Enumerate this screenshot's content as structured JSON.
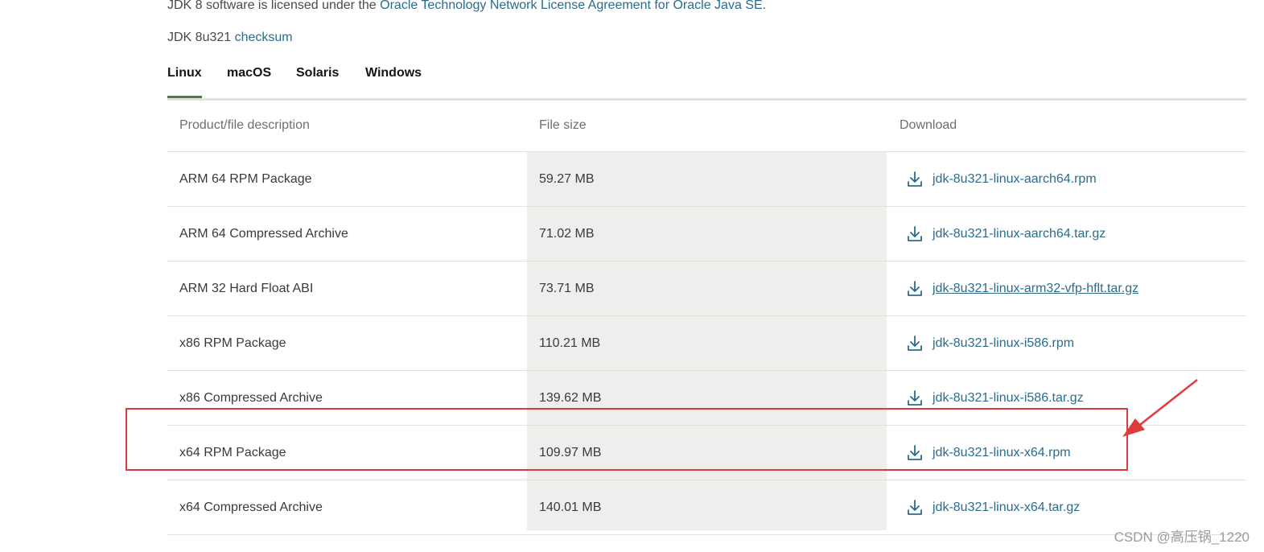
{
  "license": {
    "prefix": "JDK 8 software is licensed under the ",
    "link": "Oracle Technology Network License Agreement for Oracle Java SE",
    "suffix": "."
  },
  "checksum": {
    "prefix": "JDK 8u321 ",
    "link": "checksum"
  },
  "tabs": [
    {
      "label": "Linux",
      "active": true
    },
    {
      "label": "macOS",
      "active": false
    },
    {
      "label": "Solaris",
      "active": false
    },
    {
      "label": "Windows",
      "active": false
    }
  ],
  "table": {
    "headers": [
      "Product/file description",
      "File size",
      "Download"
    ],
    "rows": [
      {
        "description": "ARM 64 RPM Package",
        "size": "59.27 MB",
        "file": "jdk-8u321-linux-aarch64.rpm"
      },
      {
        "description": "ARM 64 Compressed Archive",
        "size": "71.02 MB",
        "file": "jdk-8u321-linux-aarch64.tar.gz"
      },
      {
        "description": "ARM 32 Hard Float ABI",
        "size": "73.71 MB",
        "file": "jdk-8u321-linux-arm32-vfp-hflt.tar.gz"
      },
      {
        "description": "x86 RPM Package",
        "size": "110.21 MB",
        "file": "jdk-8u321-linux-i586.rpm"
      },
      {
        "description": "x86 Compressed Archive",
        "size": "139.62 MB",
        "file": "jdk-8u321-linux-i586.tar.gz"
      },
      {
        "description": "x64 RPM Package",
        "size": "109.97 MB",
        "file": "jdk-8u321-linux-x64.rpm"
      },
      {
        "description": "x64 Compressed Archive",
        "size": "140.01 MB",
        "file": "jdk-8u321-linux-x64.tar.gz"
      }
    ],
    "download_icon": "download-icon"
  },
  "annotation": {
    "highlighted_row": "x64 RPM Package",
    "color": "#e0393e"
  },
  "watermark": "CSDN @高压锅_1220",
  "colors": {
    "link": "#2b6c8c",
    "tab_active_underline": "#4e7a45",
    "size_column_bg": "#efeeec"
  }
}
